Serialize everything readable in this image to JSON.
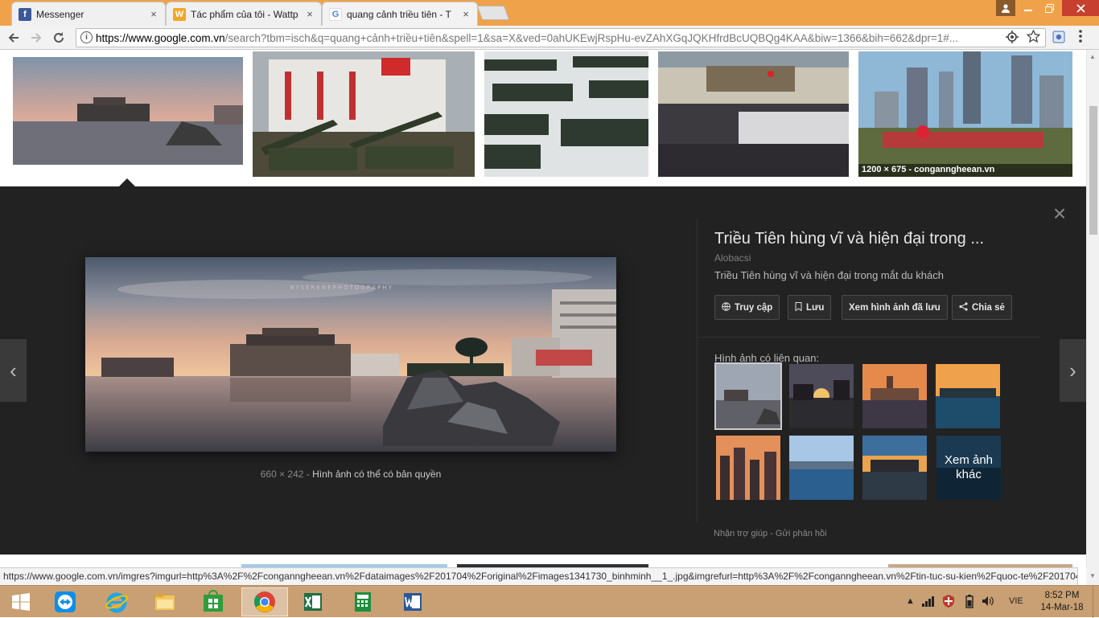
{
  "browser": {
    "tabs": [
      {
        "label": "Messenger",
        "icon": "facebook-icon",
        "icon_color": "#3b5998",
        "icon_glyph": "f",
        "close": "×"
      },
      {
        "label": "Tác phẩm của tôi - Wattp",
        "icon": "wattpad-icon",
        "icon_color": "#f5a623",
        "icon_glyph": "W",
        "close": "×"
      },
      {
        "label": "quang cảnh triều tiên - T",
        "icon": "google-icon",
        "icon_color": "#4285f4",
        "icon_glyph": "G",
        "close": "×"
      }
    ],
    "url_host": "https://www.google.com.vn",
    "url_rest": "/search?tbm=isch&q=quang+cảnh+triều+tiên&spell=1&sa=X&ved=0ahUKEwjRspHu-evZAhXGqJQKHfrdBcUQBQg4KAA&biw=1366&bih=662&dpr=1#..."
  },
  "results_top": [
    {
      "caption": ""
    },
    {
      "caption": ""
    },
    {
      "caption": ""
    },
    {
      "caption": ""
    },
    {
      "caption": "1200 × 675 - conganngheean.vn"
    }
  ],
  "preview": {
    "image_dimensions": "660 × 242",
    "separator": "-",
    "copyright_note": "Hình ảnh có thể có bản quyền",
    "watermark": "BYSERENEPHOTOGRAPHY",
    "close_glyph": "×",
    "prev_glyph": "‹",
    "next_glyph": "›",
    "title": "Triều Tiên hùng vĩ và hiện đại trong ...",
    "source": "Alobacsi",
    "description": "Triều Tiên hùng vĩ và hiện đại trong mắt du khách",
    "actions": {
      "visit": "Truy cập",
      "save": "Lưu",
      "view_saved": "Xem hình ảnh đã lưu",
      "share": "Chia sẻ"
    },
    "related_label": "Hình ảnh có liên quan:",
    "more_label": "Xem ảnh khác",
    "feedback": {
      "help": "Nhận trợ giúp",
      "sep": " - ",
      "send": "Gửi phản hồi"
    }
  },
  "status_url": "https://www.google.com.vn/imgres?imgurl=http%3A%2F%2Fconganngheean.vn%2Fdataimages%2F201704%2Foriginal%2Fimages1341730_binhminh__1_.jpg&imgrefurl=http%3A%2F%2Fconganngheean.vn%2Ftin-tuc-su-kien%2Fquoc-te%2F201704%2F...",
  "taskbar": {
    "language": "VIE",
    "time": "8:52 PM",
    "date": "14-Mar-18",
    "apps": [
      "windows-start-icon",
      "teamviewer-icon",
      "internet-explorer-icon",
      "file-explorer-icon",
      "windows-store-icon",
      "chrome-icon",
      "excel-icon",
      "calculator-icon",
      "word-icon"
    ]
  },
  "colors": {
    "titlebar": "#f0a24a",
    "panel": "#222222",
    "taskbar": "#c9a073"
  }
}
